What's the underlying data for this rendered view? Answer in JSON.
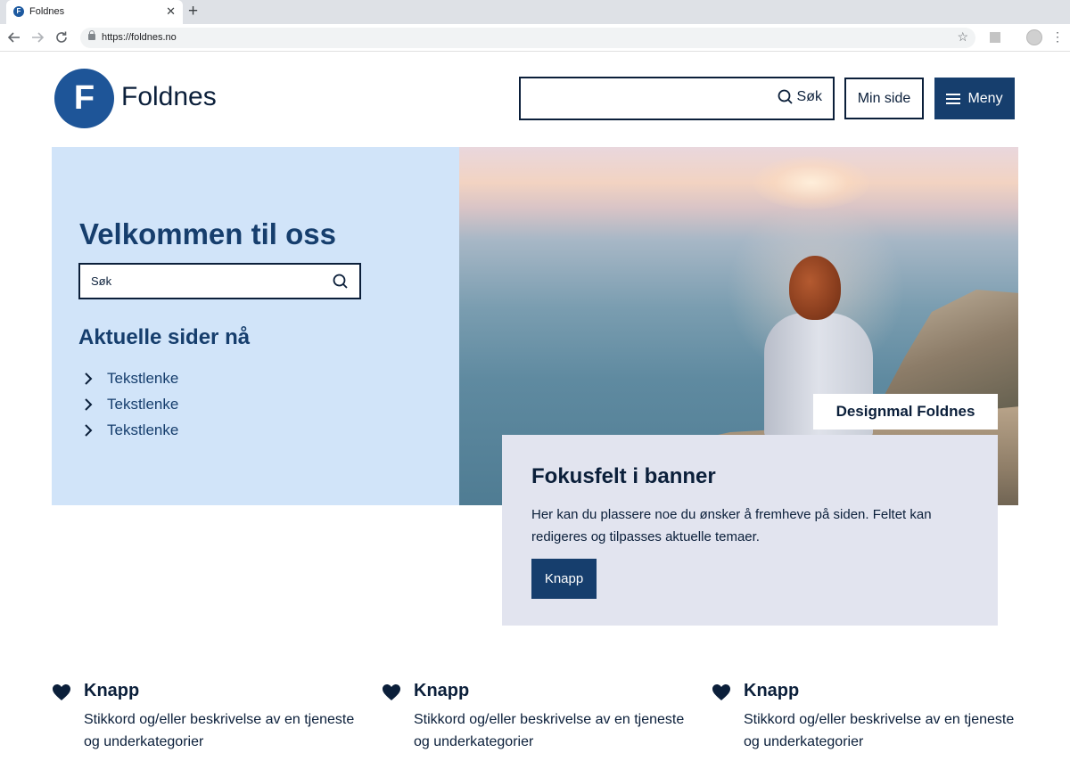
{
  "browser": {
    "tab_title": "Foldnes",
    "favicon_letter": "F",
    "close_glyph": "✕",
    "newtab_glyph": "+",
    "url": "https://foldnes.no",
    "star_glyph": "☆",
    "menu_glyph": "⋮"
  },
  "header": {
    "logo_letter": "F",
    "logo_text": "Foldnes",
    "search_label": "Søk",
    "minside_label": "Min side",
    "menu_label": "Meny"
  },
  "hero": {
    "title": "Velkommen til oss",
    "search_placeholder": "Søk",
    "subtitle": "Aktuelle sider nå",
    "links": [
      "Tekstlenke",
      "Tekstlenke",
      "Tekstlenke"
    ],
    "image_caption": "Designmal Foldnes"
  },
  "focus": {
    "title": "Fokusfelt i banner",
    "text": "Her kan du plassere noe du ønsker å fremheve på siden. Feltet kan redigeres og tilpasses aktuelle temaer.",
    "button_label": "Knapp"
  },
  "cards": [
    {
      "title": "Knapp",
      "description": "Stikkord og/eller beskrivelse av en tjeneste og underkategorier",
      "icon": "heart-icon"
    },
    {
      "title": "Knapp",
      "description": "Stikkord og/eller beskrivelse av en tjeneste og underkategorier",
      "icon": "heart-icon"
    },
    {
      "title": "Knapp",
      "description": "Stikkord og/eller beskrivelse av en tjeneste og underkategorier",
      "icon": "heart-icon"
    }
  ],
  "colors": {
    "brand_dark": "#163e6d",
    "logo_blue": "#1e5598",
    "hero_bg": "#d1e4f9",
    "focus_bg": "#e2e4ef",
    "text": "#0b1f3a"
  }
}
